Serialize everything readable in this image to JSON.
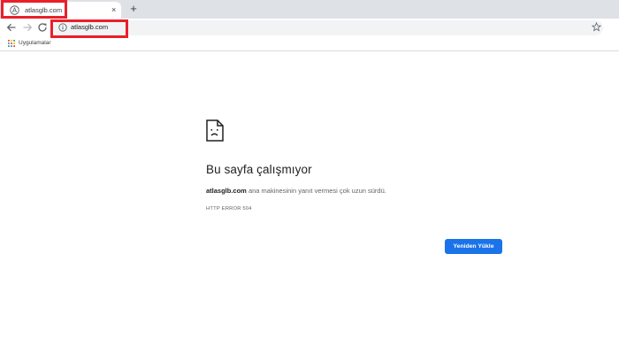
{
  "tab": {
    "title": "atlasglb.com",
    "close_glyph": "×",
    "favicon": "globe-a-icon"
  },
  "newtab": {
    "glyph": "+"
  },
  "toolbar": {
    "url": "atlasglb.com",
    "back": "back-arrow-icon",
    "forward": "forward-arrow-icon",
    "reload": "reload-icon",
    "star": "star-icon"
  },
  "bookmarks": {
    "apps_label": "Uygulamalar"
  },
  "error": {
    "title": "Bu sayfa çalışmıyor",
    "host": "atlasglb.com",
    "description": " ana makinesinin yanıt vermesi çok uzun sürdü.",
    "code": "HTTP ERROR 504",
    "reload_label": "Yeniden Yükle"
  },
  "colors": {
    "highlight": "#e8202a",
    "accent": "#1a73e8",
    "tabstrip": "#dee1e6"
  }
}
